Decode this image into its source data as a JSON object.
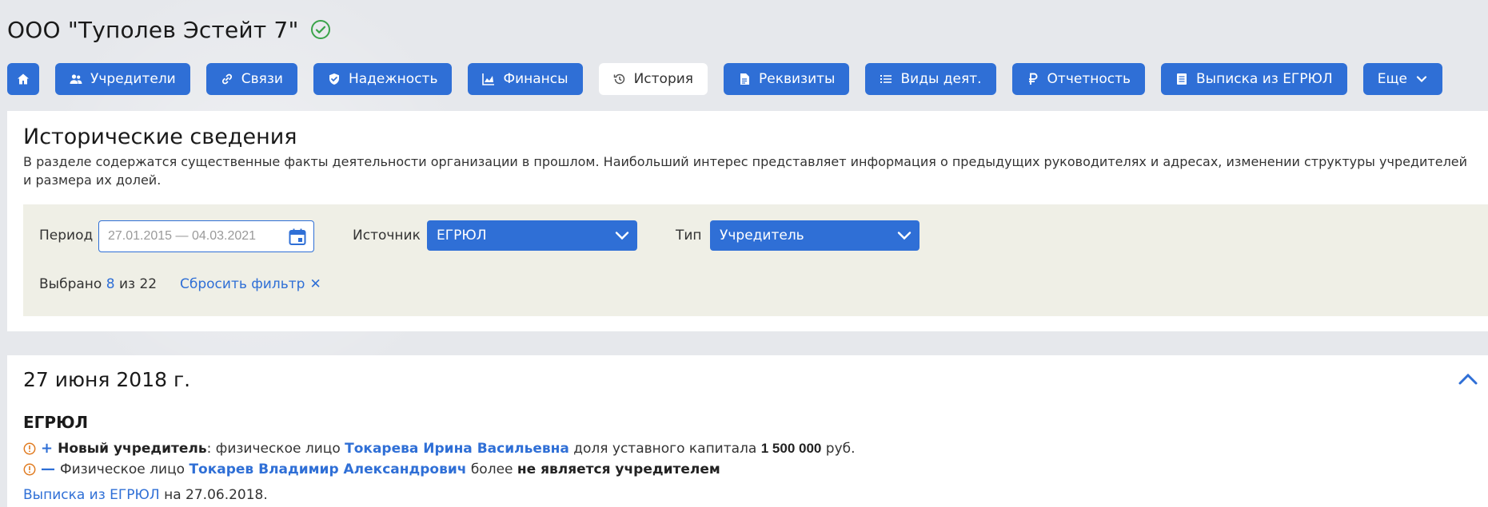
{
  "company": {
    "title": "ООО \"Туполев Эстейт 7\"",
    "verified_icon": "check-circle-icon"
  },
  "tabs": [
    {
      "label": "",
      "icon": "home-icon"
    },
    {
      "label": "Учредители",
      "icon": "users-icon"
    },
    {
      "label": "Связи",
      "icon": "link-icon"
    },
    {
      "label": "Надежность",
      "icon": "shield-icon"
    },
    {
      "label": "Финансы",
      "icon": "chart-icon"
    },
    {
      "label": "История",
      "icon": "history-icon",
      "active": true
    },
    {
      "label": "Реквизиты",
      "icon": "document-icon"
    },
    {
      "label": "Виды деят.",
      "icon": "list-icon"
    },
    {
      "label": "Отчетность",
      "icon": "ruble-icon"
    },
    {
      "label": "Выписка из ЕГРЮЛ",
      "icon": "register-icon"
    },
    {
      "label": "Еще",
      "icon": "chevron-down-icon"
    }
  ],
  "history": {
    "title": "Исторические сведения",
    "description": "В разделе содержатся существенные факты деятельности организации в прошлом. Наибольший интерес представляет информация о предыдущих руководителях и адресах, изменении структуры учредителей и размера их долей.",
    "filter": {
      "period_label": "Период",
      "period_value": "27.01.2015 — 04.03.2021",
      "source_label": "Источник",
      "source_value": "ЕГРЮЛ",
      "type_label": "Тип",
      "type_value": "Учредитель",
      "selected_prefix": "Выбрано",
      "selected_count": "8",
      "selected_mid": "из",
      "selected_total": "22",
      "reset_label": "Сбросить фильтр",
      "reset_icon": "✕"
    }
  },
  "event": {
    "date": "27 июня 2018 г.",
    "source": "ЕГРЮЛ",
    "line1": {
      "bold_label": "Новый учредитель",
      "colon": ":",
      "text1": " физическое лицо ",
      "person": "Токарева Ирина Васильевна",
      "text2": " доля уставного капитала ",
      "amount": "1 500 000",
      "text3": " руб."
    },
    "line2": {
      "text1": "Физическое лицо ",
      "person": "Токарев Владимир Александрович",
      "text2": " более ",
      "bold": "не является учредителем"
    },
    "extract_link": "Выписка из ЕГРЮЛ",
    "extract_suffix": " на 27.06.2018."
  },
  "colors": {
    "accent": "#2f6fd6",
    "warning": "#e07b20",
    "verified": "#3aa34a",
    "filter_bg": "#efefe6",
    "page_bg": "#e6e8ec"
  }
}
